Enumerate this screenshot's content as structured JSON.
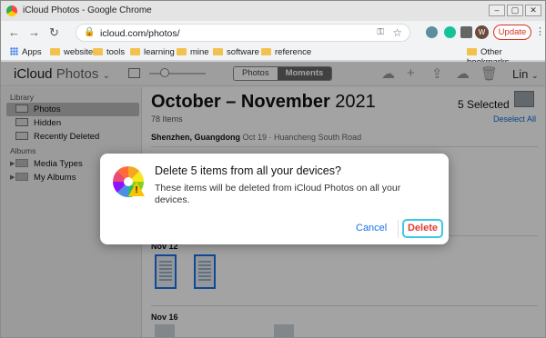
{
  "browser": {
    "tab_title": "iCloud Photos - Google Chrome",
    "url": "icloud.com/photos/",
    "update_label": "Update",
    "profile_initial": "W",
    "window_controls": [
      "minimize",
      "maximize",
      "close"
    ]
  },
  "bookmarks": {
    "apps_label": "Apps",
    "items": [
      "website",
      "tools",
      "learning",
      "mine",
      "software",
      "reference"
    ],
    "other_label": "Other bookmarks"
  },
  "icloud": {
    "brand_name": "iCloud",
    "brand_app": "Photos",
    "brand_chevron": "⌄",
    "view_tabs": [
      "Photos",
      "Moments"
    ],
    "active_view": "Moments",
    "user_name": "Lin",
    "user_chevron": "⌄"
  },
  "sidebar": {
    "library_header": "Library",
    "library_items": [
      "Photos",
      "Hidden",
      "Recently Deleted"
    ],
    "selected_item": "Photos",
    "albums_header": "Albums",
    "album_items": [
      "Media Types",
      "My Albums"
    ]
  },
  "main": {
    "title_months": "October – November",
    "title_year": "2021",
    "item_count": "78 Items",
    "selected_count": "5 Selected",
    "deselect_label": "Deselect All",
    "location": "Shenzhen, Guangdong",
    "location_detail": "Oct 19 · Huancheng South Road",
    "date_1": "Nov 12",
    "date_2": "Nov 16"
  },
  "dialog": {
    "title": "Delete 5 items from all your devices?",
    "body": "These items will be deleted from iCloud Photos on all your devices.",
    "cancel_label": "Cancel",
    "delete_label": "Delete",
    "warning_mark": "!",
    "accent_color": "#1a73e8",
    "danger_color": "#e03c31"
  }
}
